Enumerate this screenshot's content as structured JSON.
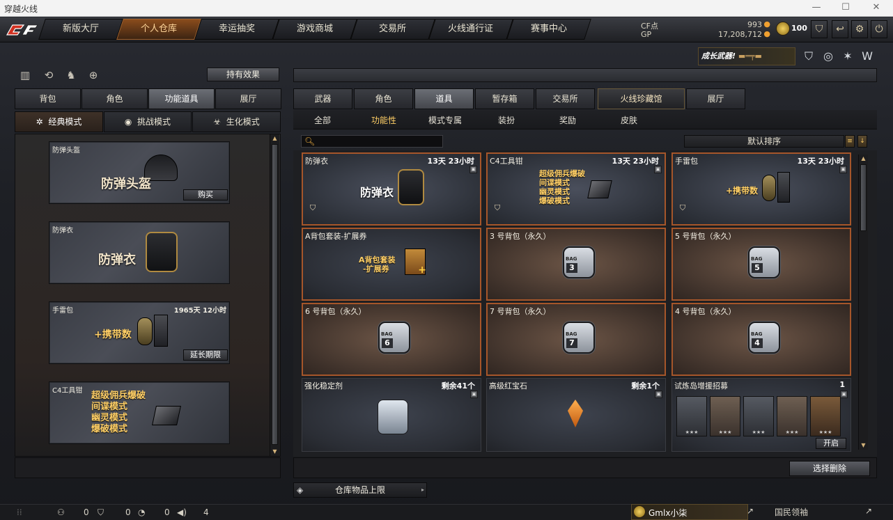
{
  "window": {
    "title": "穿越火线"
  },
  "nav": {
    "tabs": [
      "新版大厅",
      "个人仓库",
      "幸运抽奖",
      "游戏商城",
      "交易所",
      "火线通行证",
      "赛事中心"
    ],
    "active": 1
  },
  "currency": {
    "cf_label": "CF点",
    "cf_value": "993",
    "gp_label": "GP",
    "gp_value": "17,208,712",
    "level": "100"
  },
  "banner": {
    "text": "成长武器!"
  },
  "left": {
    "effect_button": "持有效果",
    "tabs": [
      "背包",
      "角色",
      "功能道具",
      "展厅"
    ],
    "active_tab": 2,
    "modes": [
      "经典模式",
      "挑战模式",
      "生化模式"
    ],
    "active_mode": 0,
    "cards": [
      {
        "name": "防弹头盔",
        "big": "防弹头盔",
        "time": "",
        "action": "购买"
      },
      {
        "name": "防弹衣",
        "big": "防弹衣",
        "time": "",
        "action": ""
      },
      {
        "name": "手雷包",
        "big": "+携带数",
        "time": "1965天 12小时",
        "action": "延长期限"
      },
      {
        "name": "C4工具钳",
        "modes": [
          "超级佣兵爆破",
          "间谍模式",
          "幽灵模式",
          "爆破模式"
        ],
        "time": "",
        "action": ""
      }
    ]
  },
  "right": {
    "tabs": [
      "武器",
      "角色",
      "道具",
      "暂存箱",
      "交易所",
      "火线珍藏馆",
      "展厅"
    ],
    "active_tab": 2,
    "subtabs": [
      "全部",
      "功能性",
      "模式专属",
      "装扮",
      "奖励",
      "皮肤"
    ],
    "active_subtab": 1,
    "search_placeholder": "",
    "sort_label": "默认排序",
    "items": [
      {
        "name": "防弹衣",
        "time": "13天 23小时",
        "big": "防弹衣"
      },
      {
        "name": "C4工具钳",
        "time": "13天 23小时",
        "modes": [
          "超级佣兵爆破",
          "间谍模式",
          "幽灵模式",
          "爆破模式"
        ]
      },
      {
        "name": "手雷包",
        "time": "13天 23小时",
        "big": "+携带数"
      },
      {
        "name": "A背包套装-扩展券",
        "time": "",
        "coupon": [
          "A背包套装",
          "-扩展券"
        ]
      },
      {
        "name": "3 号背包（永久）",
        "time": "",
        "bag": "3"
      },
      {
        "name": "5 号背包（永久）",
        "time": "",
        "bag": "5"
      },
      {
        "name": "6 号背包（永久）",
        "time": "",
        "bag": "6"
      },
      {
        "name": "7 号背包（永久）",
        "time": "",
        "bag": "7"
      },
      {
        "name": "4 号背包（永久）",
        "time": "",
        "bag": "4"
      },
      {
        "name": "强化稳定剂",
        "time": "剩余41个"
      },
      {
        "name": "高级红宝石",
        "time": "剩余1个"
      },
      {
        "name": "试炼岛增援招募",
        "time": "1",
        "action": "开启"
      }
    ],
    "bag_label": "BAG",
    "delete_button": "选择删除",
    "capacity_label": "仓库物品上限"
  },
  "status": {
    "items": [
      "0",
      "0",
      "0",
      "4"
    ],
    "username": "Gmlx小柒",
    "right_label": "国民领袖"
  }
}
